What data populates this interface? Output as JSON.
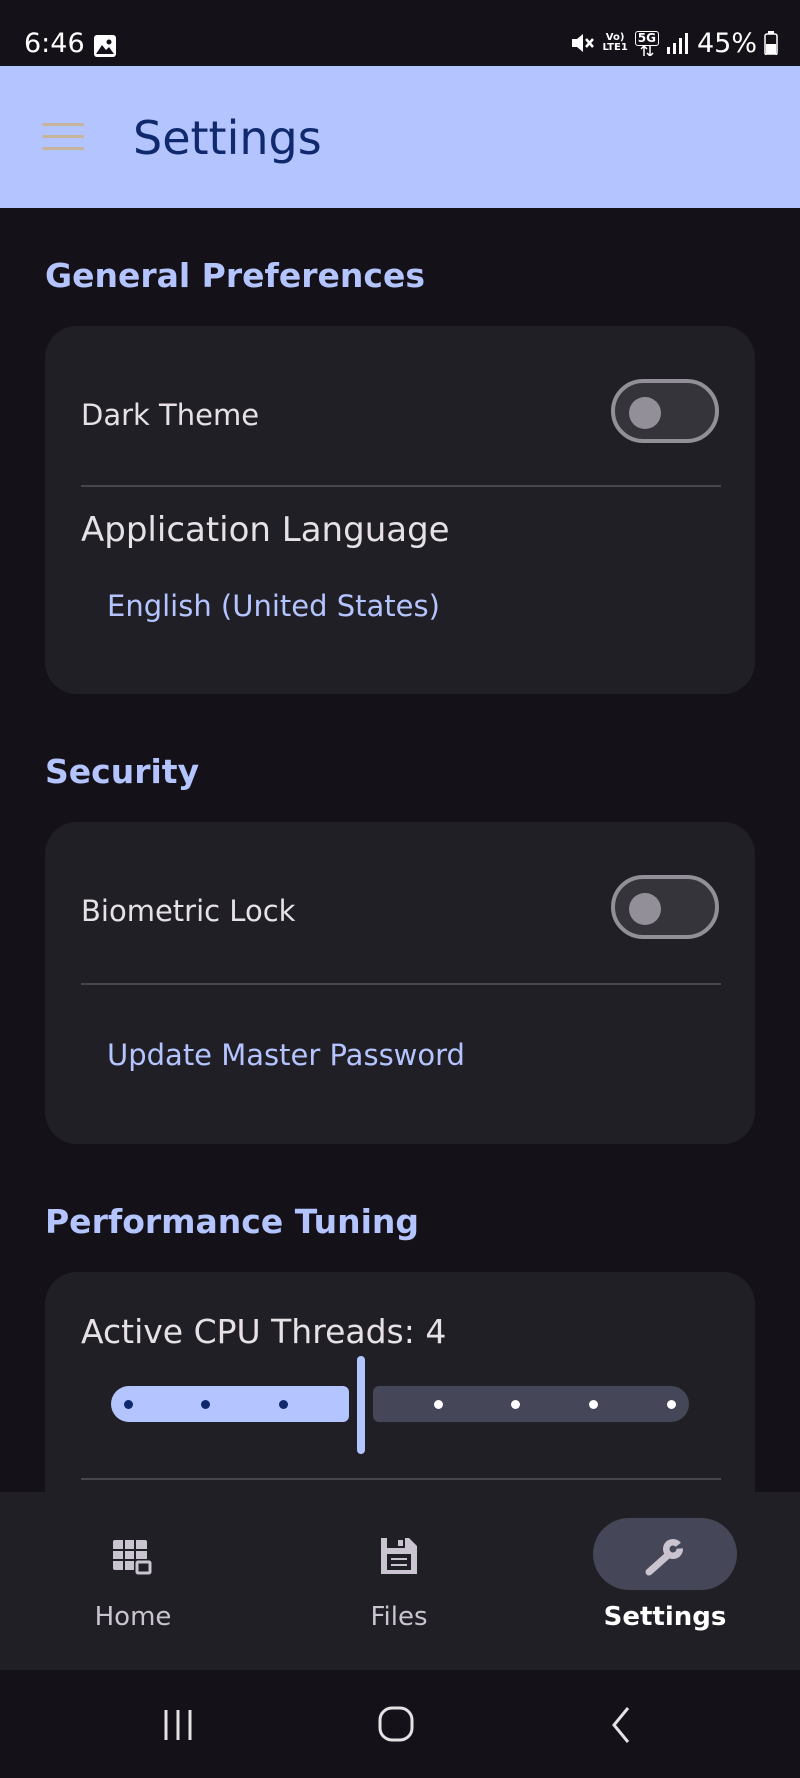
{
  "status_bar": {
    "time": "6:46",
    "volte_top": "Vo)",
    "volte_bottom": "LTE1",
    "network": "5G",
    "battery": "45%"
  },
  "app_bar": {
    "title": "Settings"
  },
  "sections": {
    "general": {
      "title": "General Preferences",
      "dark_theme_label": "Dark Theme",
      "dark_theme_on": false,
      "language_label": "Application Language",
      "language_value": "English (United States)"
    },
    "security": {
      "title": "Security",
      "biometric_label": "Biometric Lock",
      "biometric_on": false,
      "update_password_label": "Update Master Password"
    },
    "performance": {
      "title": "Performance Tuning",
      "threads_label": "Active CPU Threads: 4",
      "threads_value": 4,
      "threads_min": 1,
      "threads_max": 8
    }
  },
  "bottom_nav": {
    "items": [
      {
        "label": "Home",
        "icon": "home-grid-icon",
        "active": false
      },
      {
        "label": "Files",
        "icon": "save-disk-icon",
        "active": false
      },
      {
        "label": "Settings",
        "icon": "wrench-icon",
        "active": true
      }
    ]
  },
  "colors": {
    "accent": "#b4c4ff",
    "surface": "#211f26",
    "background": "#141218"
  }
}
